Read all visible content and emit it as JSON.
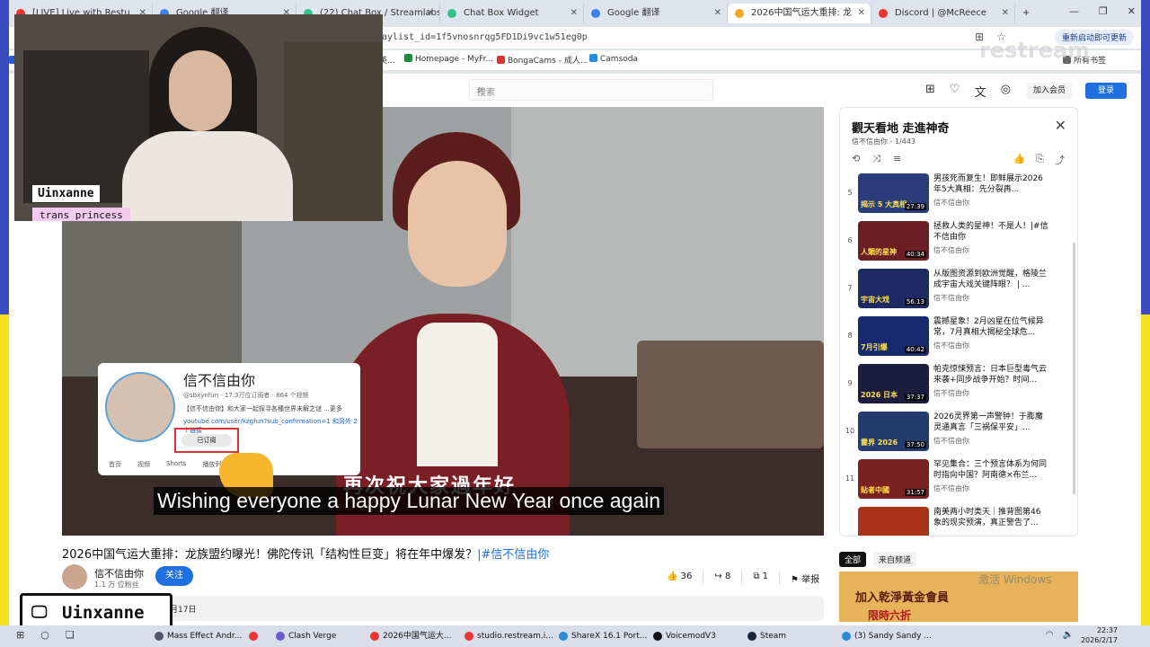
{
  "browser": {
    "tabs": [
      {
        "title": "[LIVE] Live with Restu",
        "color": "#e33"
      },
      {
        "title": "Google 翻译",
        "color": "#3b82f6"
      },
      {
        "title": "(22) Chat Box / Streamlabs",
        "color": "#31c48d"
      },
      {
        "title": "Chat Box Widget",
        "color": "#31c48d"
      },
      {
        "title": "Google 翻译",
        "color": "#3b82f6"
      },
      {
        "title": "2026中国气运大重排: 龙",
        "color": "#f5a623",
        "active": true
      },
      {
        "title": "Discord | @McReece",
        "color": "#e33"
      }
    ],
    "new_tab": "+",
    "url": "aylist_id=1f5vnosnrqg5FD1Di9vc1w51eg0p",
    "restart_label": "重新启动即可更新",
    "watermark": "restream",
    "bookmarks": [
      {
        "label": "Q2暴民 - Can...",
        "color": "#2a5bd7"
      },
      {
        "label": "新分资",
        "color": "#111"
      },
      {
        "label": "屡屡少年终成屡...游...",
        "color": "#e88a1a"
      },
      {
        "label": "K.K 霍梅英文教...",
        "color": "#d33"
      },
      {
        "label": "语言陪拼，学会英...",
        "color": "#d33"
      },
      {
        "label": "Homepage - MyFr...",
        "color": "#1e8a3a"
      },
      {
        "label": "BongaCams - 成人...",
        "color": "#d33"
      },
      {
        "label": "Camsoda",
        "color": "#2a8bd7"
      },
      {
        "label": "所有书签",
        "color": "#666"
      }
    ]
  },
  "youtube": {
    "search_placeholder": "搜索",
    "join_label": "加入会员",
    "login_label": "登录"
  },
  "video": {
    "subtitle_cn": "再次祝大家過年好",
    "subtitle_en": "Wishing everyone a happy Lunar New Year once again",
    "card": {
      "name": "信不信由你",
      "meta": "@sbxynfun · 17.3万位订阅者 · 864 个视频",
      "desc": "【信不信由你】和大家一起探寻各種世界未解之谜 ...更多",
      "link": "youtube.com/user/kzgfun?sub_confirmation=1 和另外 2 个链接",
      "subscribe": "已订阅",
      "tabs": [
        "首页",
        "视频",
        "Shorts",
        "播放列表",
        "社区"
      ]
    },
    "title": "2026中国气运大重排：龙族盟约曝光！佛陀传讯「结构性巨变」将在年中爆发？",
    "hashtag": "|#信不信由你",
    "channel": "信不信由你",
    "channel_subs": "1.1 万 位粉丝",
    "follow": "关注",
    "likes": "36",
    "shares": "8",
    "saves": "1",
    "report": "举报",
    "desc_date": "月17日"
  },
  "playlist": {
    "title": "觀天看地 走進神奇",
    "meta": "信不信由你 - 1/443",
    "items": [
      {
        "num": "5",
        "title": "男孩死而复生！即鲜展示2026年5大真相：先分裂再...",
        "channel": "信不信由你",
        "duration": "27:39",
        "label": "揭示 5 大真相",
        "bg": "#2a3d7a"
      },
      {
        "num": "6",
        "title": "拯救人类的星神！不是人！|#信不信由你",
        "channel": "信不信由你",
        "duration": "40:34",
        "label": "人類的星神",
        "bg": "#6b1f24"
      },
      {
        "num": "7",
        "title": "从版图资源到欧洲觉醒，格陵兰成宇宙大戏关键阵眼？ | ...",
        "channel": "信不信由你",
        "duration": "56:13",
        "label": "宇宙大戏",
        "bg": "#1d2a63"
      },
      {
        "num": "8",
        "title": "震撼星象！2月凶星在位气候异常，7月真相大揭秘全球危...",
        "channel": "信不信由你",
        "duration": "40:42",
        "label": "7月引爆",
        "bg": "#182a6e"
      },
      {
        "num": "9",
        "title": "帕克惊悚预言：日本巨型毒气云来袭+同步战争开始？时间...",
        "channel": "信不信由你",
        "duration": "37:37",
        "label": "2026 日本",
        "bg": "#1c1c3c"
      },
      {
        "num": "10",
        "title": "2026灵界第一声警钟！于膨魔灵通真言「三祸保平安」...",
        "channel": "信不信由你",
        "duration": "37:50",
        "label": "靈界 2026",
        "bg": "#243b6e"
      },
      {
        "num": "11",
        "title": "罕见集合：三个预言体系为何同时指向中国？阿南德×布兰...",
        "channel": "信不信由你",
        "duration": "31:57",
        "label": "貼者中國",
        "bg": "#7a2222"
      },
      {
        "num": "",
        "title": "南美两小时类天｜推背图第46象的现实预演，真正警告了...",
        "channel": "",
        "duration": "",
        "label": "",
        "bg": "#a8321a"
      }
    ],
    "chips": [
      "全部",
      "来自频道"
    ]
  },
  "ad": {
    "line1": "加入乾淨黃金會員",
    "line2": "限時六折",
    "windows": "激活 Windows"
  },
  "overlay": {
    "nametag": "Uinxanne",
    "pronoun": "trans princess",
    "bigname": "Uinxanne"
  },
  "taskbar": {
    "items": [
      {
        "label": "Mass Effect Andr...",
        "color": "#556"
      },
      {
        "label": "",
        "color": "#e33"
      },
      {
        "label": "Clash Verge",
        "color": "#6a5acd"
      },
      {
        "label": "2026中国气运大...",
        "color": "#e33"
      },
      {
        "label": "studio.restream.i...",
        "color": "#e33"
      },
      {
        "label": "ShareX 16.1 Port...",
        "color": "#2a8bd7"
      },
      {
        "label": "VoicemodV3",
        "color": "#111"
      },
      {
        "label": "Steam",
        "color": "#1b2838"
      },
      {
        "label": "(3) Sandy Sandy ...",
        "color": "#2a8bd7"
      }
    ],
    "time": "22:37",
    "date": "2026/2/17"
  }
}
